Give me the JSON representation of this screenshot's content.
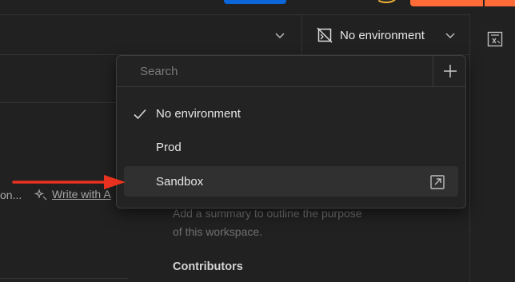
{
  "header": {
    "environment_selector_label": "No environment"
  },
  "left_panel": {
    "truncated_text": "on...",
    "ai_link_label": "Write with A"
  },
  "workspace": {
    "summary_placeholder": "Add a summary to outline the purpose of this workspace.",
    "contributors_heading": "Contributors"
  },
  "env_dropdown": {
    "search_placeholder": "Search",
    "options": [
      {
        "label": "No environment",
        "selected": true
      },
      {
        "label": "Prod",
        "selected": false
      },
      {
        "label": "Sandbox",
        "selected": false,
        "hovered": true
      }
    ]
  },
  "colors": {
    "background": "#212121",
    "dropdown_bg": "#232323",
    "hover_row": "#303030",
    "accent_orange": "#ff6c37",
    "accent_blue": "#0a66d9",
    "annotation_arrow": "#e8321f"
  },
  "icons": [
    "no-environment-icon",
    "chevron-down-icon",
    "variables-icon",
    "plus-icon",
    "check-icon",
    "open-external-icon",
    "ai-sparkle-icon"
  ]
}
